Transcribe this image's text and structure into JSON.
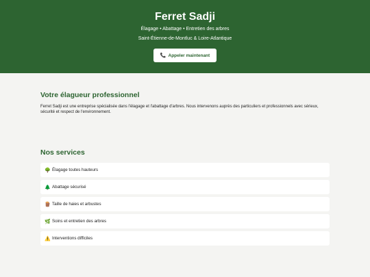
{
  "hero": {
    "title": "Ferret Sadji",
    "tagline": "Élagage • Abattage • Entretien des arbres",
    "area": "Saint-Étienne-de-Montluc & Loire-Atlantique",
    "call_button": {
      "icon": "phone-icon",
      "label": "Appeler maintenant"
    }
  },
  "about": {
    "title": "Votre élagueur professionnel",
    "text": "Ferret Sadji est une entreprise spécialisée dans l'élagage et l'abattage d'arbres. Nous intervenons auprès des particuliers et professionnels avec sérieux, sécurité et respect de l'environnement."
  },
  "services": {
    "title": "Nos services",
    "items": [
      {
        "icon": "🌳",
        "label": "Élagage toutes hauteurs"
      },
      {
        "icon": "🌲",
        "label": "Abattage sécurisé"
      },
      {
        "icon": "🪵",
        "label": "Taille de haies et arbustes"
      },
      {
        "icon": "🌿",
        "label": "Soins et entretien des arbres"
      },
      {
        "icon": "⚠️",
        "label": "Interventions difficiles"
      }
    ]
  },
  "colors": {
    "brand": "#2d6431",
    "background": "#f4f4f2",
    "card": "#ffffff"
  }
}
